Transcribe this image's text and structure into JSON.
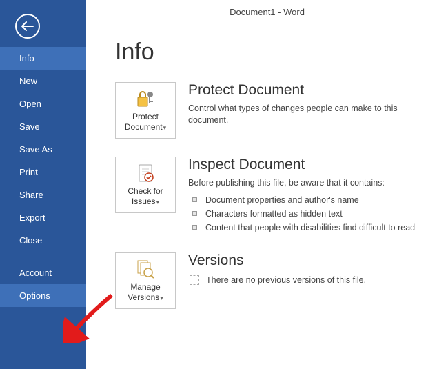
{
  "titlebar": "Document1 - Word",
  "page_title": "Info",
  "sidebar": {
    "items": [
      {
        "label": "Info",
        "active": true
      },
      {
        "label": "New"
      },
      {
        "label": "Open"
      },
      {
        "label": "Save"
      },
      {
        "label": "Save As"
      },
      {
        "label": "Print"
      },
      {
        "label": "Share"
      },
      {
        "label": "Export"
      },
      {
        "label": "Close"
      }
    ],
    "footer_items": [
      {
        "label": "Account"
      },
      {
        "label": "Options"
      }
    ]
  },
  "sections": {
    "protect": {
      "tile_line1": "Protect",
      "tile_line2": "Document",
      "title": "Protect Document",
      "desc": "Control what types of changes people can make to this document."
    },
    "inspect": {
      "tile_line1": "Check for",
      "tile_line2": "Issues",
      "title": "Inspect Document",
      "desc": "Before publishing this file, be aware that it contains:",
      "bullets": [
        "Document properties and author's name",
        "Characters formatted as hidden text",
        "Content that people with disabilities find difficult to read"
      ]
    },
    "versions": {
      "tile_line1": "Manage",
      "tile_line2": "Versions",
      "title": "Versions",
      "empty_text": "There are no previous versions of this file."
    }
  }
}
